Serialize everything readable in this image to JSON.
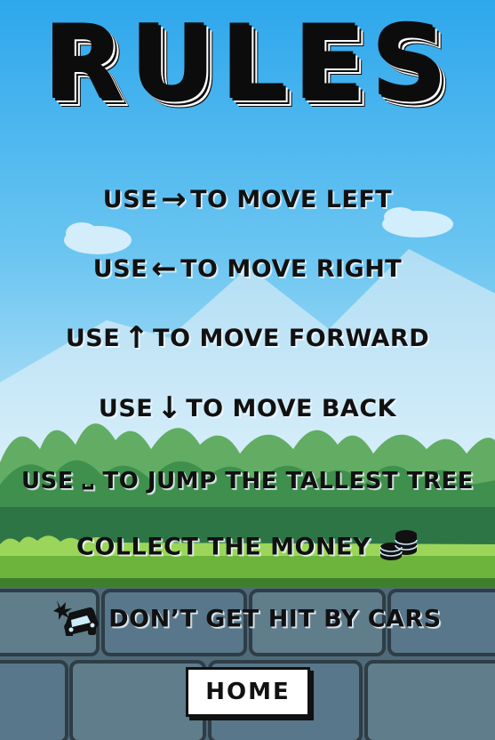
{
  "title": "RULES",
  "rules": [
    {
      "prefix": "USE",
      "icon": "arrow-right-icon",
      "glyph": "→",
      "text": "TO MOVE LEFT"
    },
    {
      "prefix": "USE",
      "icon": "arrow-left-icon",
      "glyph": "←",
      "text": "TO MOVE RIGHT"
    },
    {
      "prefix": "USE",
      "icon": "arrow-up-icon",
      "glyph": "↑",
      "text": "TO MOVE FORWARD"
    },
    {
      "prefix": "USE",
      "icon": "arrow-down-icon",
      "glyph": "↓",
      "text": "TO MOVE BACK"
    },
    {
      "prefix": "USE",
      "icon": "spacebar-icon",
      "glyph": "⎵",
      "text": "TO JUMP THE TALLEST TREE"
    },
    {
      "text": "COLLECT THE MONEY",
      "icon": "coins-icon"
    },
    {
      "icon": "car-crash-icon",
      "text": "DON’T GET HIT BY CARS"
    }
  ],
  "home_button": "HOME",
  "colors": {
    "sky_top": "#3cb1ee",
    "sky_bottom": "#cdebf9",
    "grass": "#69b13a",
    "bush": "#4a9a4b",
    "stone": "#5b7988",
    "text": "#111111"
  }
}
